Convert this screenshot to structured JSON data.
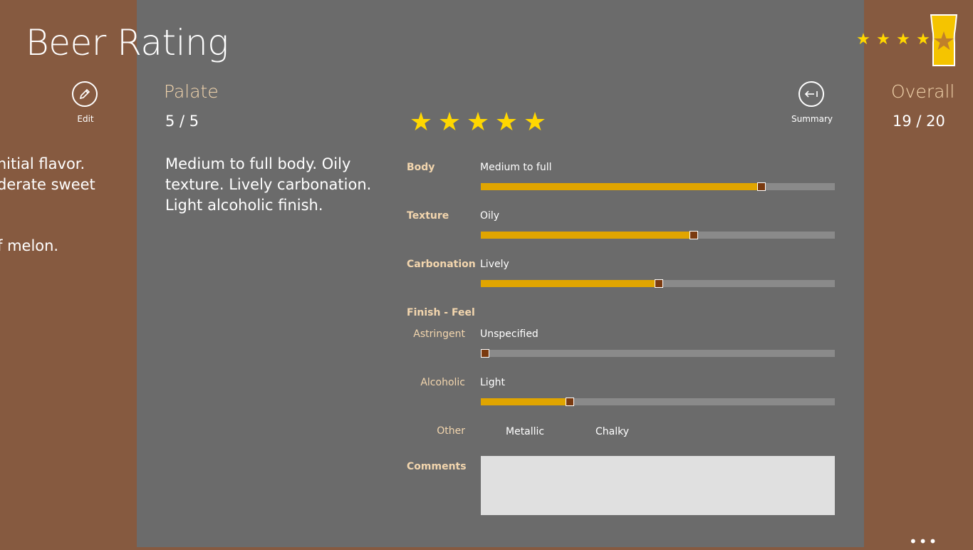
{
  "app": {
    "title": "Beer Rating"
  },
  "left": {
    "edit_label": "Edit",
    "text_lines": [
      "initial flavor.",
      "derate sweet",
      "f melon."
    ]
  },
  "palate": {
    "title": "Palate",
    "score": "5 / 5",
    "description": "Medium to full body. Oily texture. Lively carbonation. Light alcoholic finish.",
    "stars": 5,
    "summary_label": "Summary"
  },
  "attributes": {
    "body": {
      "label": "Body",
      "value": "Medium to full",
      "level": 0.79
    },
    "texture": {
      "label": "Texture",
      "value": "Oily",
      "level": 0.6
    },
    "carbonation": {
      "label": "Carbonation",
      "value": "Lively",
      "level": 0.5
    },
    "finish_heading": "Finish - Feel",
    "astringent": {
      "label": "Astringent",
      "value": "Unspecified",
      "level": 0.01
    },
    "alcoholic": {
      "label": "Alcoholic",
      "value": "Light",
      "level": 0.25
    },
    "other": {
      "label": "Other",
      "options": [
        "Metallic",
        "Chalky"
      ]
    },
    "comments": {
      "label": "Comments",
      "value": ""
    }
  },
  "overall": {
    "title": "Overall",
    "score": "19 / 20",
    "stars": 4,
    "star_fraction": 0.75
  },
  "colors": {
    "accent": "#e0a500",
    "star": "#ffd700",
    "label": "#f3d6ae",
    "panel": "#6b6b6b",
    "side": "#865a40"
  },
  "icons": {
    "edit": "pencil-icon",
    "summary": "back-arrow-icon",
    "glass": "beer-glass-icon",
    "more": "more-icon"
  }
}
